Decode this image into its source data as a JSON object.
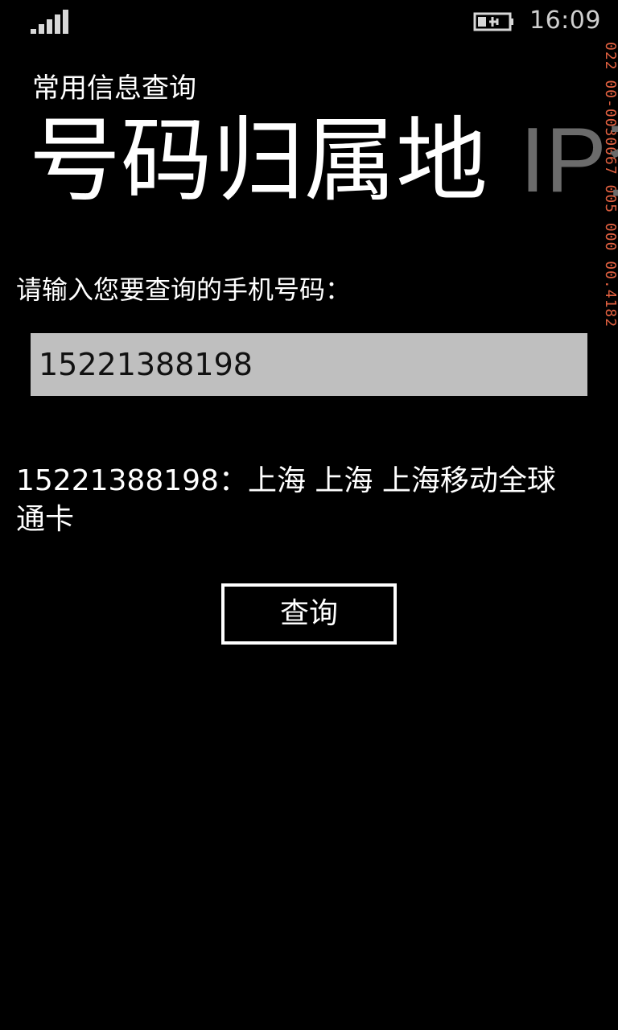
{
  "status_bar": {
    "time": "16:09",
    "signal_icon": "signal-bars-icon",
    "battery_icon": "battery-charging-icon"
  },
  "side_counter": {
    "text": "022 00-0030067 005 000 00.4182"
  },
  "app": {
    "title": "常用信息查询"
  },
  "pivot": {
    "items": [
      {
        "label": "号码归属地",
        "active": true
      },
      {
        "label": "IP查询",
        "active": false
      }
    ]
  },
  "form": {
    "prompt": "请输入您要查询的手机号码：",
    "phone_value": "15221388198",
    "result": "15221388198：上海 上海 上海移动全球通卡",
    "query_button": "查询"
  },
  "colors": {
    "background": "#000000",
    "input_background": "#bfbfbf",
    "inactive_pivot": "#6b6b6b",
    "counter_red": "#e06040"
  }
}
